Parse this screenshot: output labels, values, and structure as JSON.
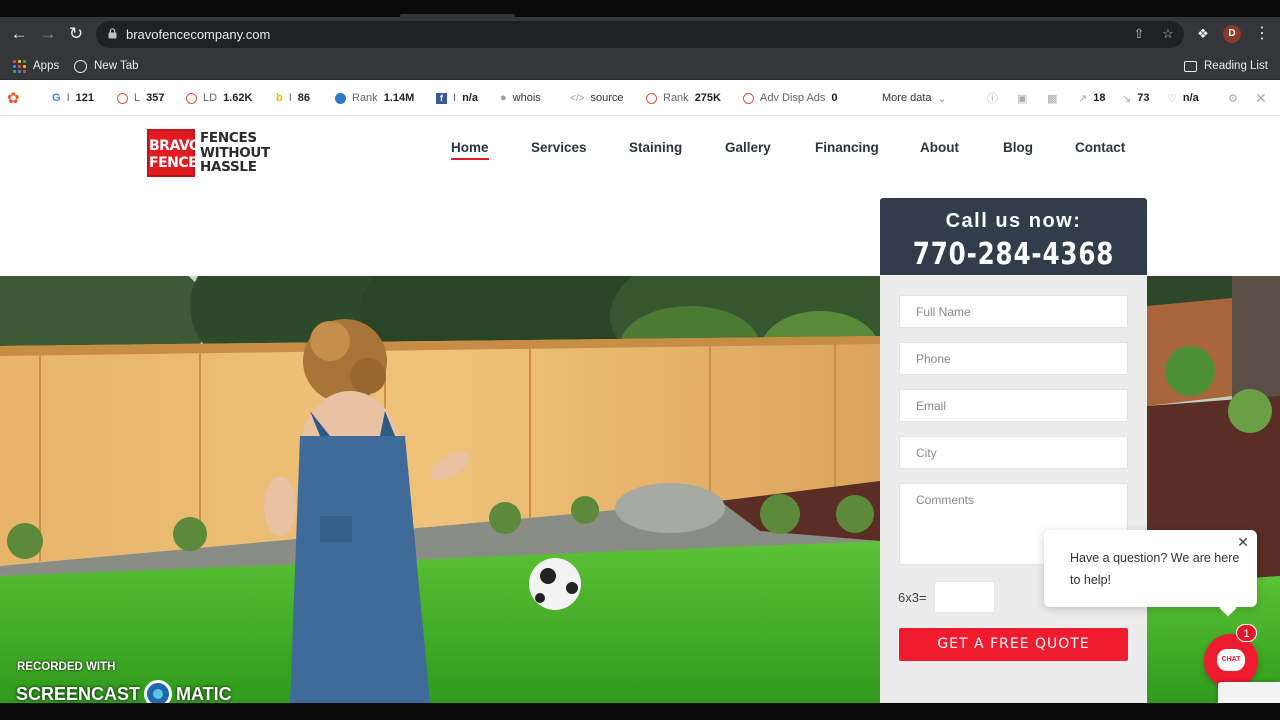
{
  "browser": {
    "url": "bravofencecompany.com",
    "profile_initial": "D",
    "bookmarks": [
      {
        "label": "Apps",
        "icon": "apps-grid-icon"
      },
      {
        "label": "New Tab",
        "icon": "globe-icon"
      }
    ],
    "reading_list": "Reading List"
  },
  "seoquake": {
    "items": [
      {
        "icon": "google-icon",
        "prefix": "I",
        "value": "121"
      },
      {
        "icon": "circle-icon",
        "prefix": "L",
        "value": "357"
      },
      {
        "icon": "circle-icon",
        "prefix": "LD",
        "value": "1.62K"
      },
      {
        "icon": "bing-icon",
        "prefix": "I",
        "value": "86"
      },
      {
        "icon": "alexa-icon",
        "prefix": "Rank",
        "value": "1.14M"
      },
      {
        "icon": "facebook-icon",
        "prefix": "I",
        "value": "n/a"
      },
      {
        "icon": "whois-icon",
        "prefix": "whois",
        "value": ""
      },
      {
        "icon": "code-icon",
        "prefix": "source",
        "value": ""
      },
      {
        "icon": "circle-icon",
        "prefix": "Rank",
        "value": "275K"
      },
      {
        "icon": "circle-icon",
        "prefix": "Adv Disp Ads",
        "value": "0"
      }
    ],
    "more_data": "More data",
    "right_values": {
      "links_ext": "18",
      "links_int": "73",
      "likes": "n/a"
    }
  },
  "site": {
    "logo": {
      "mark_line1": "BRAVO",
      "mark_line2": "FENCE",
      "tag_line1": "FENCES",
      "tag_line2": "WITHOUT",
      "tag_line3": "HASSLE"
    },
    "nav": [
      "Home",
      "Services",
      "Staining",
      "Gallery",
      "Financing",
      "About",
      "Blog",
      "Contact"
    ],
    "active_nav": "Home",
    "call_title": "Call us now:",
    "phone": "770-284-4368",
    "form": {
      "full_name": "Full Name",
      "phone": "Phone",
      "email": "Email",
      "city": "City",
      "comments": "Comments",
      "captcha_label": "6x3=",
      "submit": "GET A FREE QUOTE"
    }
  },
  "chat": {
    "message": "Have a question? We are here to help!",
    "button_label": "CHAT",
    "badge": "1"
  },
  "watermark": {
    "line1": "RECORDED WITH",
    "brand_left": "SCREENCAST",
    "brand_right": "MATIC"
  },
  "colors": {
    "brand_red": "#e01b22",
    "call_box": "#313d4a",
    "browser_chrome": "#35363a"
  }
}
